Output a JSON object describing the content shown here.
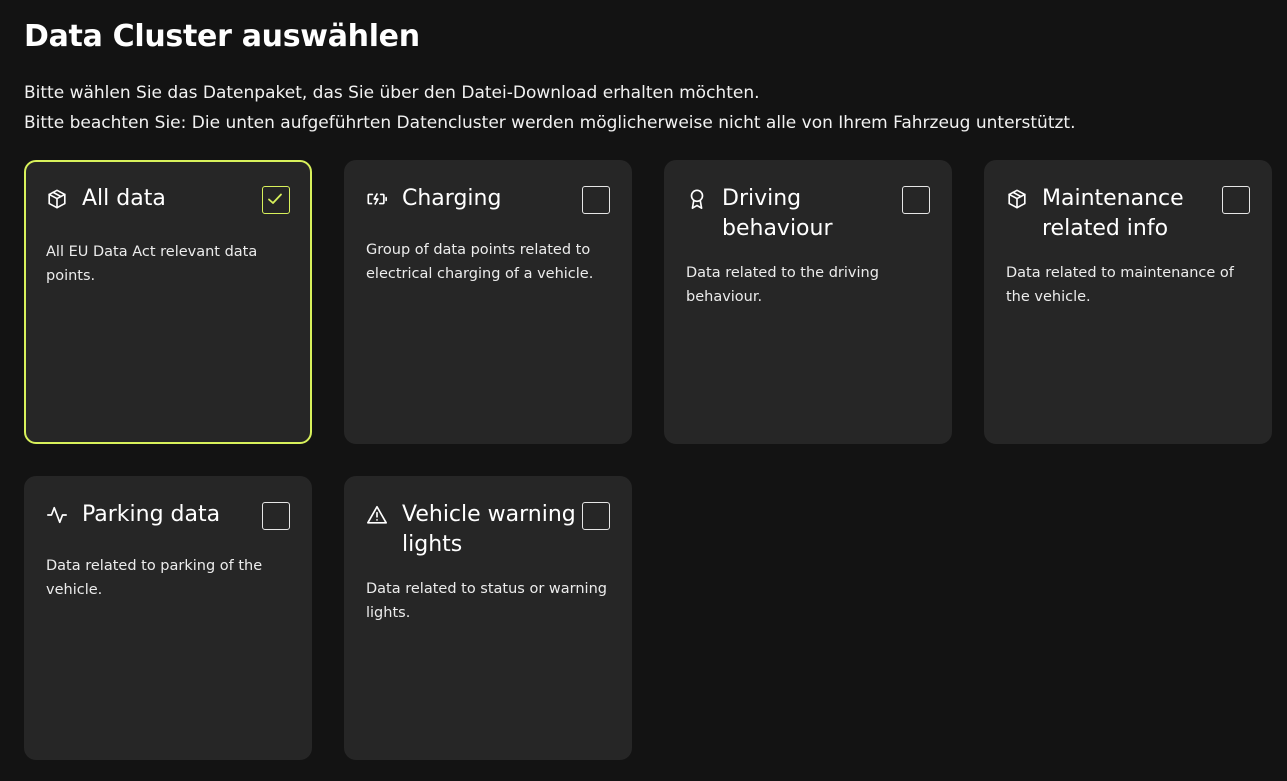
{
  "page": {
    "title": "Data Cluster auswählen",
    "intro_line1": "Bitte wählen Sie das Datenpaket, das Sie über den Datei-Download erhalten möchten.",
    "intro_line2": "Bitte beachten Sie: Die unten aufgeführten Datencluster werden möglicherweise nicht alle von Ihrem Fahrzeug unterstützt."
  },
  "clusters": [
    {
      "title": "All data",
      "description": "All EU Data Act relevant data points.",
      "icon": "package-icon",
      "checked": true
    },
    {
      "title": "Charging",
      "description": "Group of data points related to electrical charging of a vehicle.",
      "icon": "battery-charging-icon",
      "checked": false
    },
    {
      "title": "Driving behaviour",
      "description": "Data related to the driving behaviour.",
      "icon": "award-icon",
      "checked": false
    },
    {
      "title": "Maintenance related info",
      "description": "Data related to maintenance of the vehicle.",
      "icon": "package-icon",
      "checked": false
    },
    {
      "title": "Parking data",
      "description": "Data related to parking of the vehicle.",
      "icon": "activity-icon",
      "checked": false
    },
    {
      "title": "Vehicle warning lights",
      "description": "Data related to status or warning lights.",
      "icon": "warning-triangle-icon",
      "checked": false
    }
  ],
  "colors": {
    "background": "#131313",
    "card": "#262626",
    "accent": "#d8f15b",
    "text": "#ffffff"
  }
}
